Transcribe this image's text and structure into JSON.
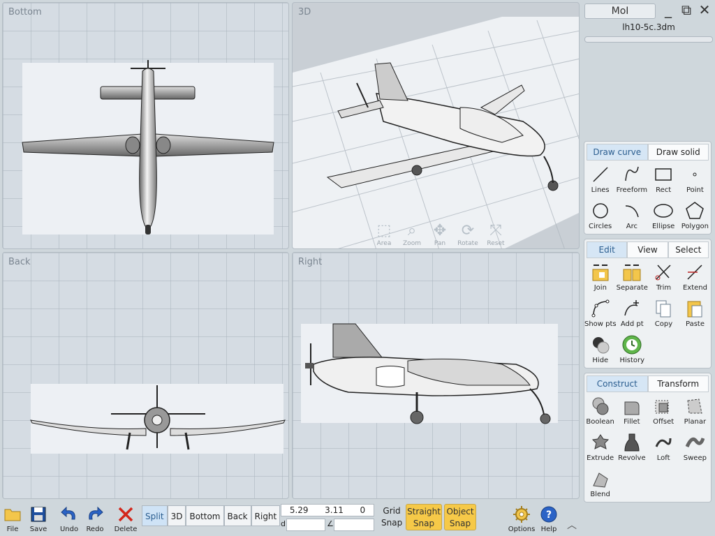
{
  "viewports": {
    "bottom": "Bottom",
    "three_d": "3D",
    "back": "Back",
    "right": "Right"
  },
  "nav_tools": [
    {
      "label": "Area",
      "icon": "zoom-area-icon"
    },
    {
      "label": "Zoom",
      "icon": "zoom-icon"
    },
    {
      "label": "Pan",
      "icon": "pan-icon"
    },
    {
      "label": "Rotate",
      "icon": "rotate-icon"
    },
    {
      "label": "Reset",
      "icon": "reset-view-icon"
    }
  ],
  "panel": {
    "app_badge": "MoI",
    "file_name": "lh10-5c.3dm",
    "draw": {
      "tabs": [
        "Draw curve",
        "Draw solid"
      ],
      "tools": [
        {
          "label": "Lines",
          "icon": "line-icon"
        },
        {
          "label": "Freeform",
          "icon": "freeform-icon"
        },
        {
          "label": "Rect",
          "icon": "rect-icon"
        },
        {
          "label": "Point",
          "icon": "point-icon"
        },
        {
          "label": "Circles",
          "icon": "circle-icon"
        },
        {
          "label": "Arc",
          "icon": "arc-icon"
        },
        {
          "label": "Ellipse",
          "icon": "ellipse-icon"
        },
        {
          "label": "Polygon",
          "icon": "polygon-icon"
        }
      ]
    },
    "edit": {
      "tabs": [
        "Edit",
        "View",
        "Select"
      ],
      "tools": [
        {
          "label": "Join",
          "icon": "join-icon"
        },
        {
          "label": "Separate",
          "icon": "separate-icon"
        },
        {
          "label": "Trim",
          "icon": "trim-icon"
        },
        {
          "label": "Extend",
          "icon": "extend-icon"
        },
        {
          "label": "Show pts",
          "icon": "show-points-icon"
        },
        {
          "label": "Add pt",
          "icon": "add-point-icon"
        },
        {
          "label": "Copy",
          "icon": "copy-icon"
        },
        {
          "label": "Paste",
          "icon": "paste-icon"
        },
        {
          "label": "Hide",
          "icon": "hide-icon"
        },
        {
          "label": "History",
          "icon": "history-icon"
        }
      ]
    },
    "construct": {
      "tabs": [
        "Construct",
        "Transform"
      ],
      "tools": [
        {
          "label": "Boolean",
          "icon": "boolean-icon"
        },
        {
          "label": "Fillet",
          "icon": "fillet-icon"
        },
        {
          "label": "Offset",
          "icon": "offset-icon"
        },
        {
          "label": "Planar",
          "icon": "planar-icon"
        },
        {
          "label": "Extrude",
          "icon": "extrude-icon"
        },
        {
          "label": "Revolve",
          "icon": "revolve-icon"
        },
        {
          "label": "Loft",
          "icon": "loft-icon"
        },
        {
          "label": "Sweep",
          "icon": "sweep-icon"
        },
        {
          "label": "Blend",
          "icon": "blend-icon"
        }
      ]
    }
  },
  "toolbar": {
    "file": "File",
    "save": "Save",
    "undo": "Undo",
    "redo": "Redo",
    "delete": "Delete",
    "views": [
      "Split",
      "3D",
      "Bottom",
      "Back",
      "Right"
    ],
    "coords": {
      "x": "5.29",
      "y": "3.11",
      "z": "0"
    },
    "distance_prefix": "d",
    "angle_prefix": "∠",
    "grid_snap": [
      "Grid",
      "Snap"
    ],
    "straight_snap": [
      "Straight",
      "Snap"
    ],
    "object_snap": [
      "Object",
      "Snap"
    ],
    "options": "Options",
    "help": "Help"
  }
}
